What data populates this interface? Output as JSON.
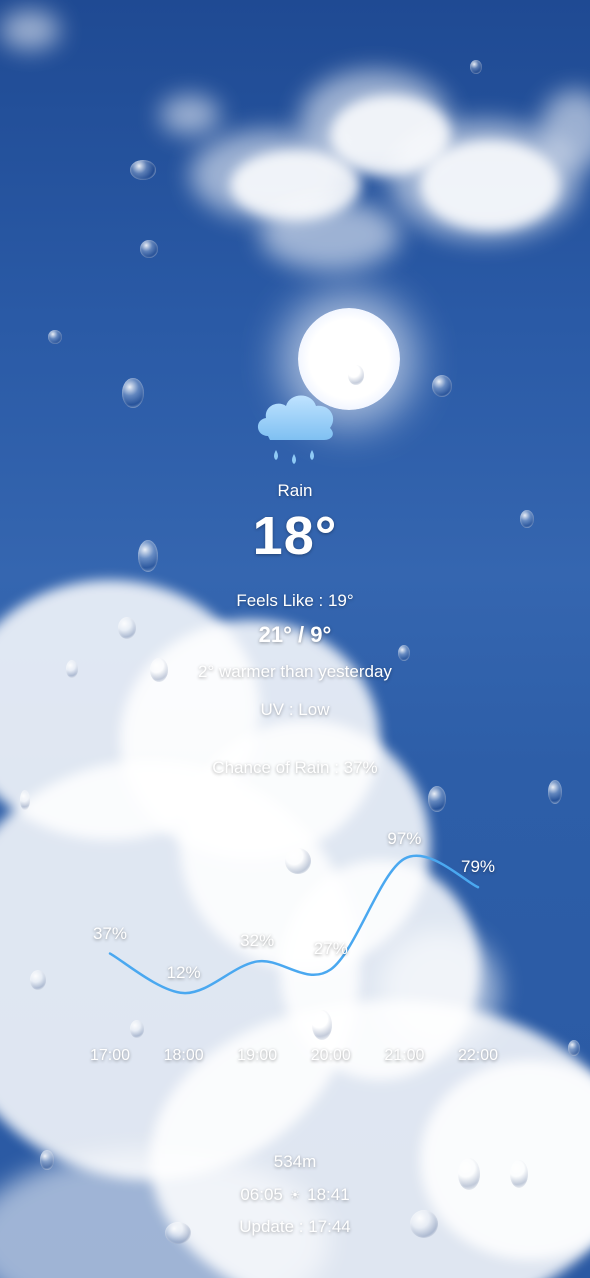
{
  "weather": {
    "condition": "Rain",
    "temperature": "18°",
    "feels_like": "Feels Like : 19°",
    "high_low": "21° / 9°",
    "comparison": "2° warmer than yesterday",
    "uv": "UV : Low",
    "chance_of_rain": "Chance of Rain : 37%",
    "icon": "rain-cloud-icon"
  },
  "chart_data": {
    "type": "line",
    "x": [
      "17:00",
      "18:00",
      "19:00",
      "20:00",
      "21:00",
      "22:00"
    ],
    "series": [
      {
        "values": [
          37,
          12,
          32,
          27,
          97,
          79
        ]
      }
    ],
    "labels": [
      "37%",
      "12%",
      "32%",
      "27%",
      "97%",
      "79%"
    ],
    "ylim": [
      0,
      100
    ],
    "color": "#4aa8f0"
  },
  "footer": {
    "altitude": "534m",
    "sunrise": "06:05",
    "sunset": "18:41",
    "sun_separator": "☀",
    "update": "Update : 17:44"
  }
}
